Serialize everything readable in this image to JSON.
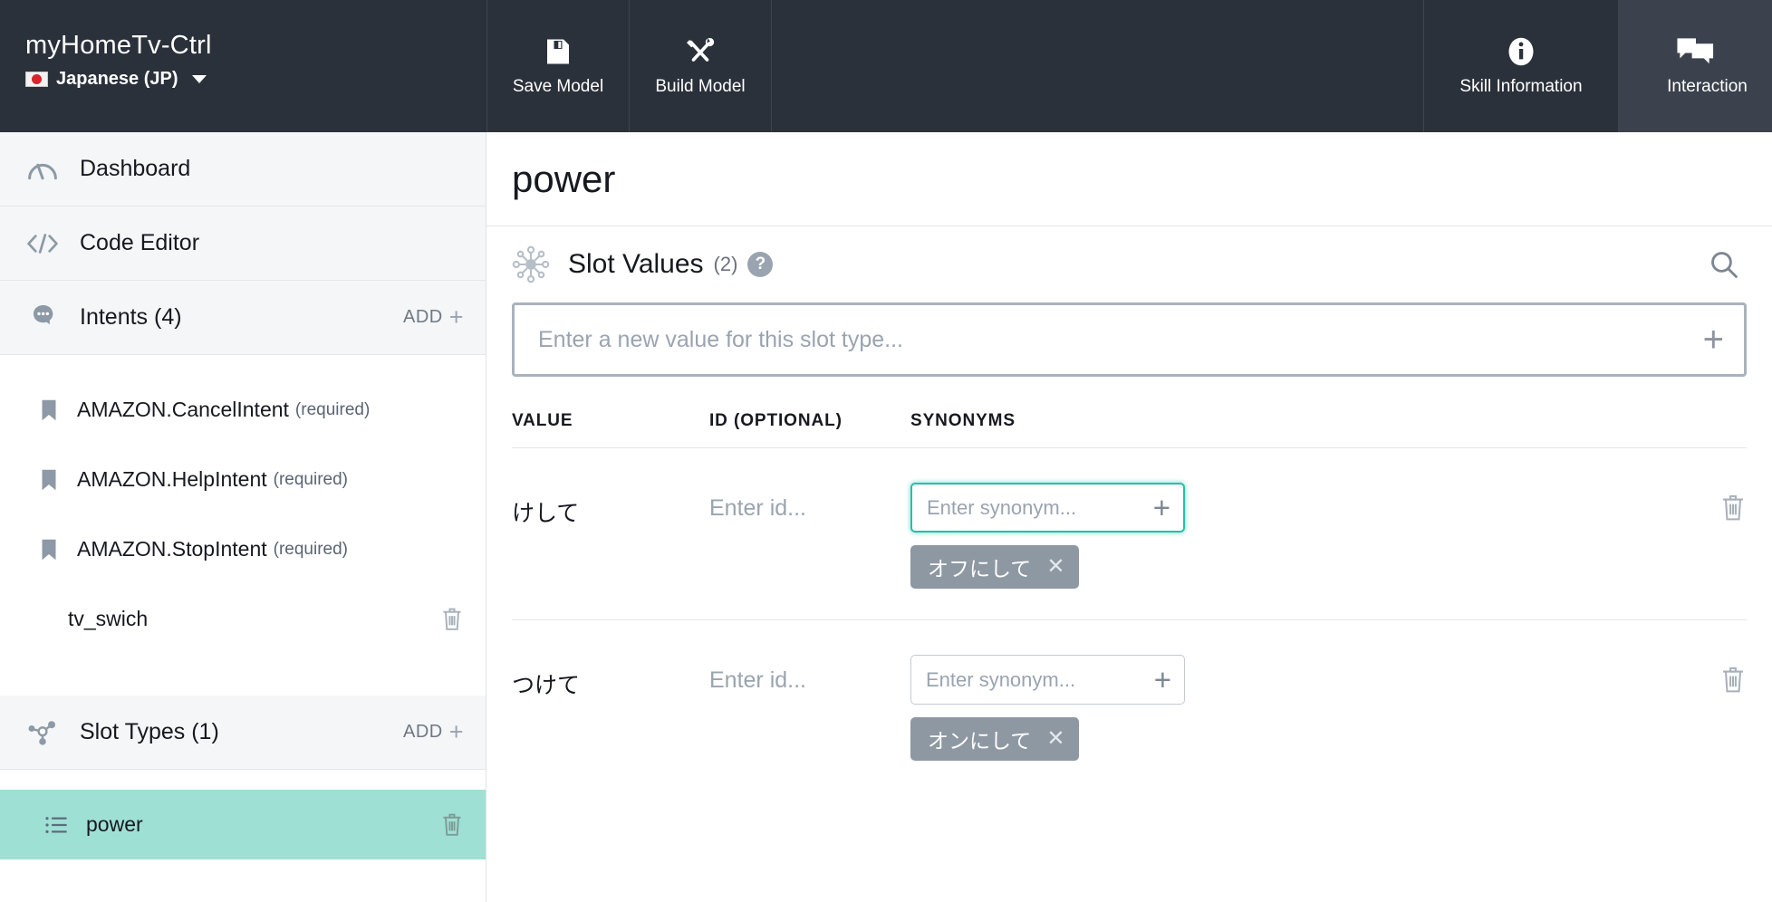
{
  "brand": {
    "title": "myHomeTv-Ctrl",
    "locale": "Japanese (JP)",
    "flag_icon": "jp-flag-icon",
    "caret_icon": "chevron-down-icon"
  },
  "toolbar": {
    "save_model": "Save Model",
    "save_icon": "floppy-disk-icon",
    "build_model": "Build Model",
    "build_icon": "hammer-wrench-icon",
    "skill_information": "Skill Information",
    "skill_info_icon": "info-circle-icon",
    "interaction_model": "Interaction",
    "interaction_icon": "speech-bubbles-icon"
  },
  "sidebar": {
    "dashboard": {
      "label": "Dashboard",
      "icon": "gauge-icon"
    },
    "code_editor": {
      "label": "Code Editor",
      "icon": "code-brackets-icon"
    },
    "intents": {
      "label": "Intents (4)",
      "icon": "head-speech-bubble-icon",
      "add_label": "ADD",
      "add_icon": "plus-icon",
      "items": [
        {
          "name": "AMAZON.CancelIntent",
          "suffix": "(required)",
          "icon": "bookmark-icon",
          "deletable": false
        },
        {
          "name": "AMAZON.HelpIntent",
          "suffix": "(required)",
          "icon": "bookmark-icon",
          "deletable": false
        },
        {
          "name": "AMAZON.StopIntent",
          "suffix": "(required)",
          "icon": "bookmark-icon",
          "deletable": false
        },
        {
          "name": "tv_swich",
          "suffix": "",
          "icon": "",
          "deletable": true
        }
      ]
    },
    "slot_types": {
      "label": "Slot Types (1)",
      "icon": "node-graph-icon",
      "add_label": "ADD",
      "add_icon": "plus-icon",
      "items": [
        {
          "name": "power",
          "icon": "list-icon",
          "selected": true,
          "deletable": true
        }
      ]
    }
  },
  "main": {
    "page_title": "power",
    "section": {
      "title": "Slot Values",
      "count": "(2)",
      "icon": "hub-spoke-icon",
      "help_icon": "question-mark-icon",
      "search_icon": "search-icon"
    },
    "new_value_input": {
      "placeholder": "Enter a new value for this slot type...",
      "value": "",
      "add_icon": "plus-icon"
    },
    "columns": [
      "VALUE",
      "ID (OPTIONAL)",
      "SYNONYMS"
    ],
    "rows": [
      {
        "value": "けして",
        "id_placeholder": "Enter id...",
        "id_value": "",
        "synonym_placeholder": "Enter synonym...",
        "synonym_value": "",
        "synonym_focused": true,
        "synonyms": [
          "オフにして"
        ],
        "delete_icon": "trash-icon"
      },
      {
        "value": "つけて",
        "id_placeholder": "Enter id...",
        "id_value": "",
        "synonym_placeholder": "Enter synonym...",
        "synonym_value": "",
        "synonym_focused": false,
        "synonyms": [
          "オンにして"
        ],
        "delete_icon": "trash-icon"
      }
    ]
  },
  "colors": {
    "topbar_bg": "#2b313b",
    "topbar_active": "#3b424d",
    "selected_row": "#9fe0d5",
    "focus_teal": "#24c1a8",
    "chip_gray": "#8e98a3",
    "muted_text": "#9aa4b0"
  }
}
